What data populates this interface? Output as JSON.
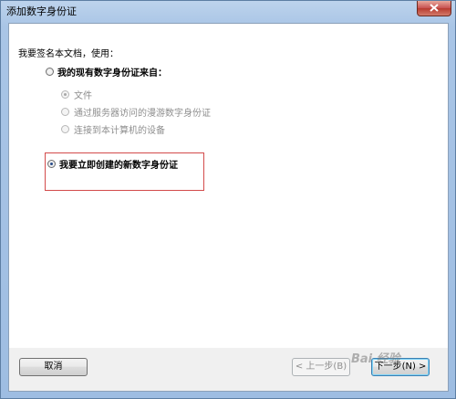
{
  "window": {
    "title": "添加数字身份证"
  },
  "content": {
    "prompt": "我要签名本文档，使用：",
    "option_existing_label": "我的现有数字身份证来自：",
    "sub_options": [
      {
        "label": "文件"
      },
      {
        "label": "通过服务器访问的漫游数字身份证"
      },
      {
        "label": "连接到本计算机的设备"
      }
    ],
    "option_new_label": "我要立即创建的新数字身份证"
  },
  "buttons": {
    "cancel": "取消",
    "back": "< 上一步(B)",
    "next": "下一步(N) >"
  },
  "watermark": "Bai 经验",
  "colors": {
    "highlight_border": "#d34b4b",
    "titlebar": "#a9c5e6",
    "close_button": "#c75050"
  }
}
